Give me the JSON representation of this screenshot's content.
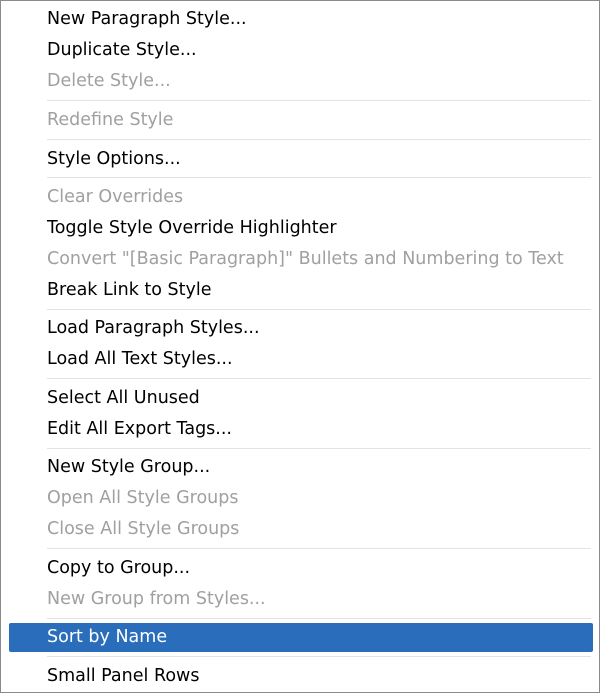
{
  "colors": {
    "enabled_text": "#000000",
    "disabled_text": "#a0a0a0",
    "highlight_bg": "#2a6ebb",
    "highlight_text": "#ffffff",
    "separator": "#e3e3e3"
  },
  "menu": {
    "items": [
      {
        "label": "New Paragraph Style...",
        "enabled": true
      },
      {
        "label": "Duplicate Style...",
        "enabled": true
      },
      {
        "label": "Delete Style...",
        "enabled": false
      },
      {
        "label": "Redefine Style",
        "enabled": false
      },
      {
        "label": "Style Options...",
        "enabled": true
      },
      {
        "label": "Clear Overrides",
        "enabled": false
      },
      {
        "label": "Toggle Style Override Highlighter",
        "enabled": true
      },
      {
        "label": "Convert \"[Basic Paragraph]\" Bullets and Numbering to Text",
        "enabled": false
      },
      {
        "label": "Break Link to Style",
        "enabled": true
      },
      {
        "label": "Load Paragraph Styles...",
        "enabled": true
      },
      {
        "label": "Load All Text Styles...",
        "enabled": true
      },
      {
        "label": "Select All Unused",
        "enabled": true
      },
      {
        "label": "Edit All Export Tags...",
        "enabled": true
      },
      {
        "label": "New Style Group...",
        "enabled": true
      },
      {
        "label": "Open All Style Groups",
        "enabled": false
      },
      {
        "label": "Close All Style Groups",
        "enabled": false
      },
      {
        "label": "Copy to Group...",
        "enabled": true
      },
      {
        "label": "New Group from Styles...",
        "enabled": false
      },
      {
        "label": "Sort by Name",
        "enabled": true,
        "highlighted": true
      },
      {
        "label": "Small Panel Rows",
        "enabled": true
      }
    ]
  }
}
